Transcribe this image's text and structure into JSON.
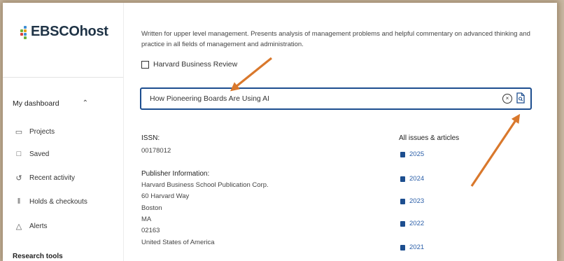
{
  "app": {
    "logo_text": "EBSCOhost"
  },
  "sidebar": {
    "section_label": "My dashboard",
    "items": [
      {
        "label": "Projects",
        "icon": "folder-icon"
      },
      {
        "label": "Saved",
        "icon": "bookmark-icon"
      },
      {
        "label": "Recent activity",
        "icon": "history-icon"
      },
      {
        "label": "Holds & checkouts",
        "icon": "books-icon"
      },
      {
        "label": "Alerts",
        "icon": "bell-icon"
      }
    ],
    "tools_label": "Research tools"
  },
  "publication": {
    "description": "Written for upper level management. Presents analysis of management problems and helpful commentary on advanced thinking and practice in all fields of management and administration.",
    "checkbox_label": "Harvard Business Review"
  },
  "search": {
    "value": "How Pioneering Boards Are Using AI"
  },
  "details": {
    "issn_label": "ISSN:",
    "issn_value": "00178012",
    "publisher_label": "Publisher Information:",
    "publisher_lines": [
      "Harvard Business School Publication Corp.",
      "60 Harvard Way",
      "Boston",
      "MA",
      "02163",
      "United States of America"
    ],
    "issues_label": "All issues & articles",
    "years": [
      "2025",
      "2024",
      "2023",
      "2022",
      "2021"
    ]
  },
  "colors": {
    "accent": "#1d4e8f",
    "link": "#2a5ea8",
    "annotation_arrow": "#d9782c"
  }
}
